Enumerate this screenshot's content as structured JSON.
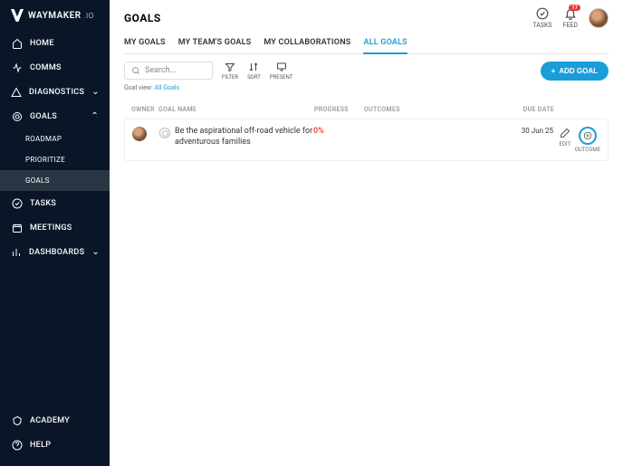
{
  "brand": {
    "name": "WAYMAKER",
    "suffix": ".IO"
  },
  "nav": {
    "home": "HOME",
    "comms": "COMMS",
    "diagnostics": "DIAGNOSTICS",
    "goals": "GOALS",
    "roadmap": "ROADMAP",
    "prioritize": "PRIORITIZE",
    "goals_sub": "GOALS",
    "tasks": "TASKS",
    "meetings": "MEETINGS",
    "dashboards": "DASHBOARDS",
    "academy": "ACADEMY",
    "help": "HELP"
  },
  "header": {
    "title": "GOALS",
    "tasks": "TASKS",
    "feed": "FEED",
    "feed_badge": "17"
  },
  "tabs": {
    "my_goals": "MY GOALS",
    "team_goals": "MY TEAM'S GOALS",
    "collab": "MY COLLABORATIONS",
    "all_goals": "ALL GOALS"
  },
  "toolbar": {
    "search_placeholder": "Search...",
    "filter": "FILTER",
    "sort": "SORT",
    "present": "PRESENT",
    "add_goal": "ADD GOAL",
    "view_label": "Goal view: ",
    "view_value": "All Goals"
  },
  "columns": {
    "owner": "OWNER",
    "goal_name": "GOAL NAME",
    "progress": "PROGRESS",
    "outcomes": "OUTCOMES",
    "due": "DUE DATE"
  },
  "rows": [
    {
      "name": "Be the aspirational off-road vehicle for adventurous families",
      "progress": "0%",
      "due": "30 Jun 25"
    }
  ],
  "actions": {
    "edit": "EDIT",
    "outcome": "OUTCOME"
  }
}
